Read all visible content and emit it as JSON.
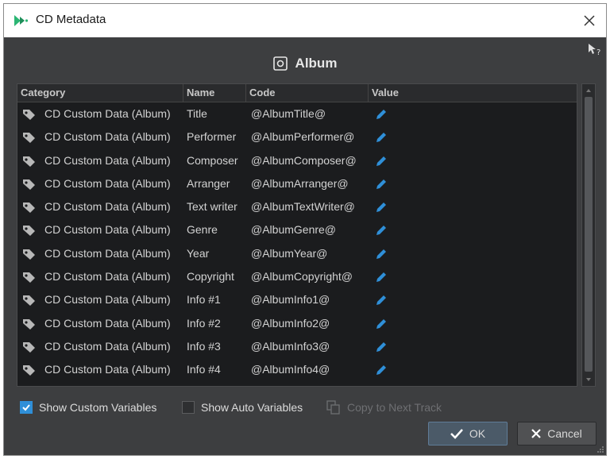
{
  "window": {
    "title": "CD Metadata"
  },
  "section": {
    "title": "Album"
  },
  "table": {
    "columns": [
      "Category",
      "Name",
      "Code",
      "Value"
    ],
    "rows": [
      {
        "category": "CD Custom Data (Album)",
        "name": "Title",
        "code": "@AlbumTitle@"
      },
      {
        "category": "CD Custom Data (Album)",
        "name": "Performer",
        "code": "@AlbumPerformer@"
      },
      {
        "category": "CD Custom Data (Album)",
        "name": "Composer",
        "code": "@AlbumComposer@"
      },
      {
        "category": "CD Custom Data (Album)",
        "name": "Arranger",
        "code": "@AlbumArranger@"
      },
      {
        "category": "CD Custom Data (Album)",
        "name": "Text writer",
        "code": "@AlbumTextWriter@"
      },
      {
        "category": "CD Custom Data (Album)",
        "name": "Genre",
        "code": "@AlbumGenre@"
      },
      {
        "category": "CD Custom Data (Album)",
        "name": "Year",
        "code": "@AlbumYear@"
      },
      {
        "category": "CD Custom Data (Album)",
        "name": "Copyright",
        "code": "@AlbumCopyright@"
      },
      {
        "category": "CD Custom Data (Album)",
        "name": "Info #1",
        "code": "@AlbumInfo1@"
      },
      {
        "category": "CD Custom Data (Album)",
        "name": "Info #2",
        "code": "@AlbumInfo2@"
      },
      {
        "category": "CD Custom Data (Album)",
        "name": "Info #3",
        "code": "@AlbumInfo3@"
      },
      {
        "category": "CD Custom Data (Album)",
        "name": "Info #4",
        "code": "@AlbumInfo4@"
      }
    ],
    "row_icon": "tag-icon",
    "value_icon": "pencil-icon"
  },
  "options": {
    "show_custom": {
      "label": "Show Custom Variables",
      "checked": true
    },
    "show_auto": {
      "label": "Show Auto Variables",
      "checked": false
    },
    "copy_next": {
      "label": "Copy to Next Track",
      "enabled": false
    }
  },
  "buttons": {
    "ok": "OK",
    "cancel": "Cancel"
  },
  "colors": {
    "accent": "#2f8fd8",
    "background": "#3d3e40",
    "table_bg": "#1b1c1e"
  }
}
